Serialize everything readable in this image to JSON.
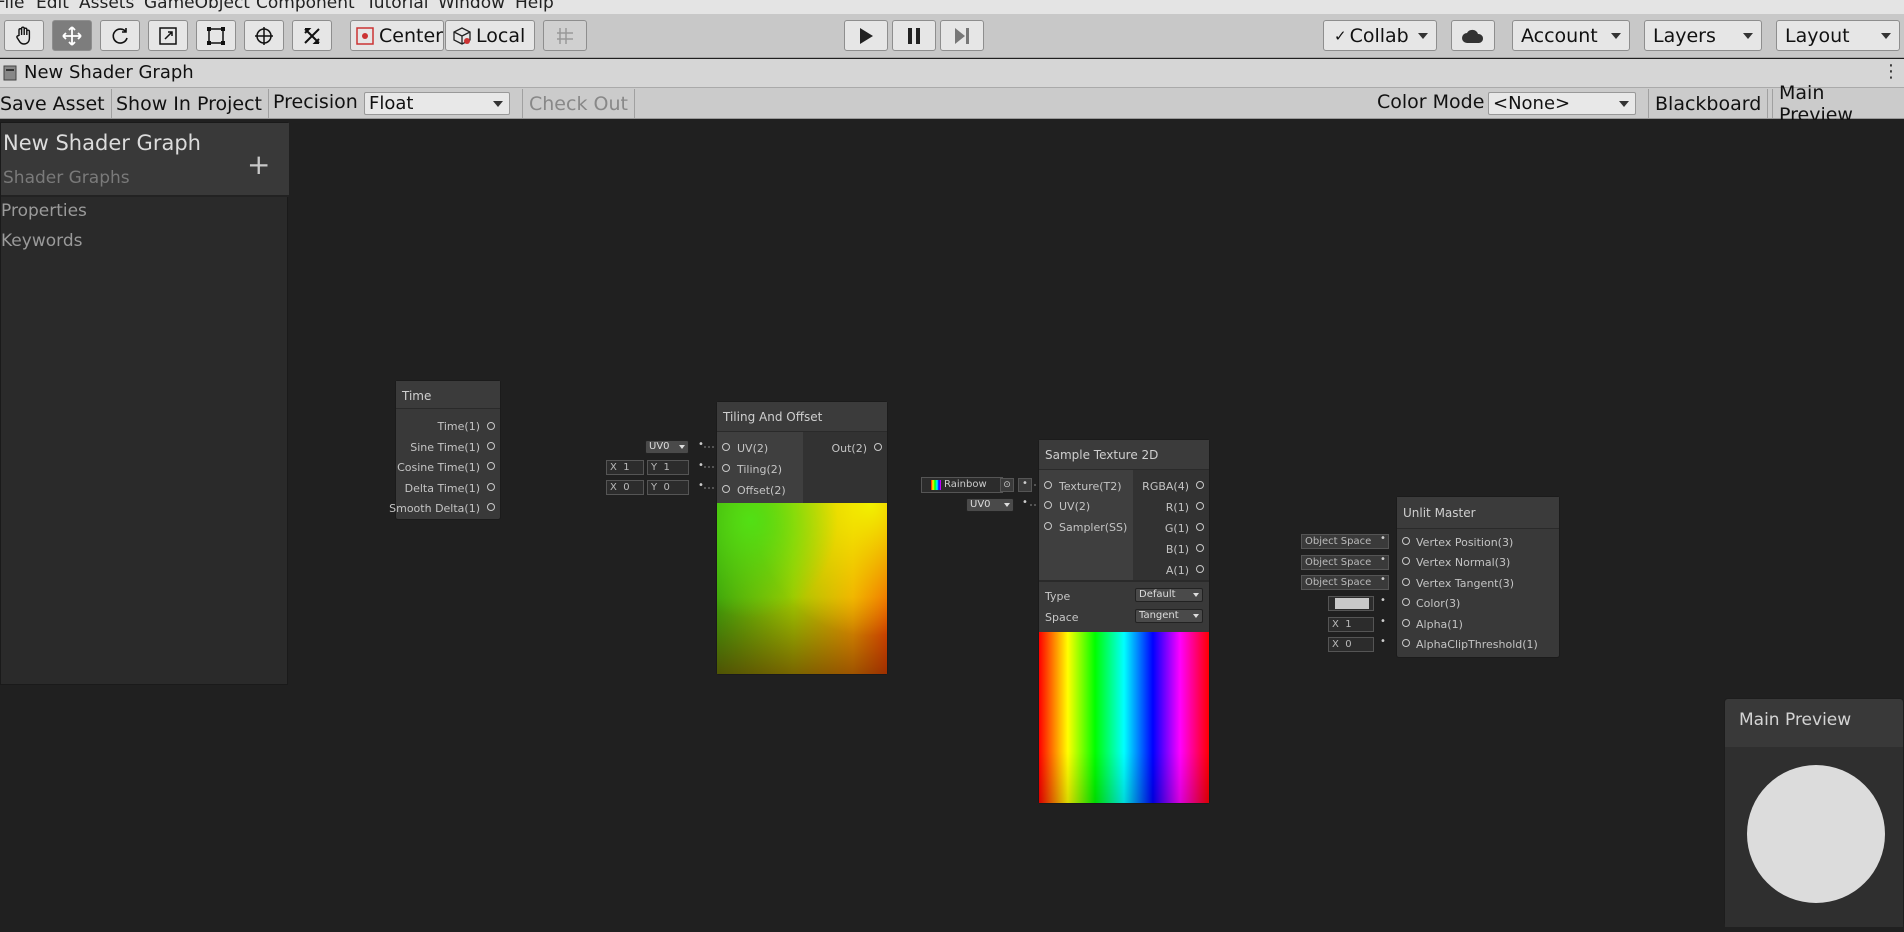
{
  "menu": [
    "File",
    "Edit",
    "Assets",
    "GameObject",
    "Component",
    "Tutorial",
    "Window",
    "Help"
  ],
  "toolbar": {
    "tools": [
      "hand-icon",
      "move-icon",
      "rotate-icon",
      "scale-icon",
      "rect-icon",
      "transform-icon",
      "custom-tool-icon"
    ],
    "pivot": "Center",
    "space": "Local",
    "grid_icon": "grid-snap-icon",
    "collab": "Collab",
    "account": "Account",
    "layers": "Layers",
    "layout": "Layout"
  },
  "tab": {
    "title": "New Shader Graph"
  },
  "graph_toolbar": {
    "save_asset": "Save Asset",
    "show_in_project": "Show In Project",
    "precision_label": "Precision",
    "precision_value": "Float",
    "check_out": "Check Out",
    "color_mode_label": "Color Mode",
    "color_mode_value": "<None>",
    "blackboard": "Blackboard",
    "main_preview": "Main Preview"
  },
  "blackboard": {
    "title": "New Shader Graph",
    "subtitle": "Shader Graphs",
    "sections": [
      "Properties",
      "Keywords"
    ]
  },
  "nodes": {
    "time": {
      "title": "Time",
      "outputs": [
        "Time(1)",
        "Sine Time(1)",
        "Cosine Time(1)",
        "Delta Time(1)",
        "Smooth Delta(1)"
      ]
    },
    "tiling": {
      "title": "Tiling And Offset",
      "inputs": [
        "UV(2)",
        "Tiling(2)",
        "Offset(2)"
      ],
      "output": "Out(2)",
      "uv_value": "UV0",
      "tiling_x_label": "X",
      "tiling_x": "1",
      "tiling_y_label": "Y",
      "tiling_y": "1",
      "offset_x_label": "X",
      "offset_x": "0",
      "offset_y_label": "Y",
      "offset_y": "0"
    },
    "sample": {
      "title": "Sample Texture 2D",
      "inputs": [
        "Texture(T2)",
        "UV(2)",
        "Sampler(SS)"
      ],
      "outputs": [
        "RGBA(4)",
        "R(1)",
        "G(1)",
        "B(1)",
        "A(1)"
      ],
      "texture_value": "Rainbow",
      "uv_value": "UV0",
      "type_label": "Type",
      "type_value": "Default",
      "space_label": "Space",
      "space_value": "Tangent"
    },
    "unlit": {
      "title": "Unlit Master",
      "inputs": [
        "Vertex Position(3)",
        "Vertex Normal(3)",
        "Vertex Tangent(3)",
        "Color(3)",
        "Alpha(1)",
        "AlphaClipThreshold(1)"
      ],
      "space1": "Object Space",
      "space2": "Object Space",
      "space3": "Object Space",
      "alpha_label": "X",
      "alpha_value": "1",
      "clip_label": "X",
      "clip_value": "0",
      "color_swatch": "#c9c9c9"
    }
  },
  "main_preview": {
    "title": "Main Preview"
  }
}
